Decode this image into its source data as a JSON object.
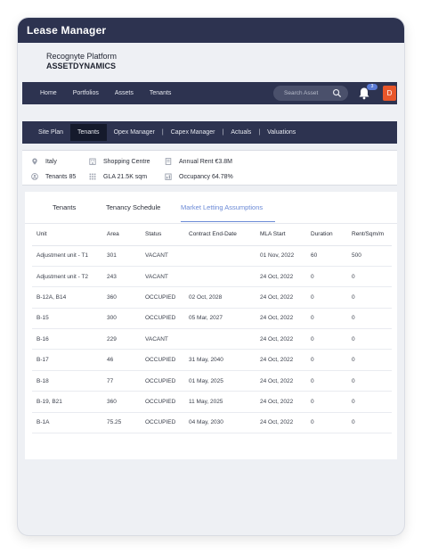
{
  "app": {
    "title": "Lease Manager"
  },
  "brand": {
    "line1": "Recognyte Platform",
    "line2": "ASSETDYNAMICS"
  },
  "nav": {
    "items": [
      "Home",
      "Portfolios",
      "Assets",
      "Tenants"
    ],
    "search_placeholder": "Search Asset",
    "notification_count": "3",
    "avatar_initial": "D"
  },
  "subnav": {
    "items": [
      "Site Plan",
      "Tenants",
      "Opex Manager",
      "Capex Manager",
      "Actuals",
      "Valuations"
    ],
    "separator": "|",
    "active": "Tenants"
  },
  "info": {
    "country": "Italy",
    "asset_type": "Shopping Centre",
    "annual_rent": "Annual Rent €3.8M",
    "tenants": "Tenants 85",
    "gla": "GLA 21.5K sqm",
    "occupancy": "Occupancy 64.78%"
  },
  "tabs": {
    "items": [
      "Tenants",
      "Tenancy Schedule",
      "Market Letting Assumptions"
    ],
    "active": "Market Letting Assumptions",
    "active_color": "#6b8ad6"
  },
  "table": {
    "headers": [
      "Unit",
      "Area",
      "Status",
      "Contract End-Date",
      "MLA Start",
      "Duration",
      "Rent/Sqm/m"
    ],
    "rows": [
      [
        "Adjustment unit - T1",
        "301",
        "VACANT",
        "",
        "01 Nov, 2022",
        "60",
        "500"
      ],
      [
        "Adjustment unit - T2",
        "243",
        "VACANT",
        "",
        "24 Oct, 2022",
        "0",
        "0"
      ],
      [
        "B-12A, B14",
        "360",
        "OCCUPIED",
        "02 Oct, 2028",
        "24 Oct, 2022",
        "0",
        "0"
      ],
      [
        "B-15",
        "300",
        "OCCUPIED",
        "05 Mar, 2027",
        "24 Oct, 2022",
        "0",
        "0"
      ],
      [
        "B-16",
        "229",
        "VACANT",
        "",
        "24 Oct, 2022",
        "0",
        "0"
      ],
      [
        "B-17",
        "46",
        "OCCUPIED",
        "31 May, 2040",
        "24 Oct, 2022",
        "0",
        "0"
      ],
      [
        "B-18",
        "77",
        "OCCUPIED",
        "01 May, 2025",
        "24 Oct, 2022",
        "0",
        "0"
      ],
      [
        "B-19, B21",
        "360",
        "OCCUPIED",
        "11 May, 2025",
        "24 Oct, 2022",
        "0",
        "0"
      ],
      [
        "B-1A",
        "75.25",
        "OCCUPIED",
        "04 May, 2030",
        "24 Oct, 2022",
        "0",
        "0"
      ]
    ]
  },
  "colors": {
    "navy": "#2d3350",
    "accent": "#6b8ad6",
    "avatar": "#e8562a"
  }
}
